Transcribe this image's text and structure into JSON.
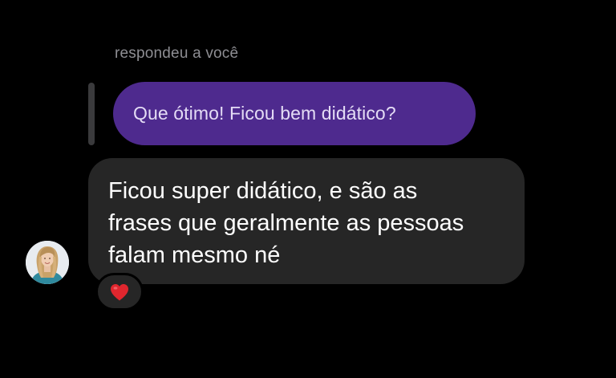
{
  "reply_header": {
    "text": "respondeu a você"
  },
  "quoted_message": {
    "text": "Que ótimo! Ficou bem didático?",
    "bubble_color": "#4e2a8e"
  },
  "message": {
    "lines": [
      "Ficou super didático, e são as",
      "frases que geralmente as pessoas",
      "falam mesmo né"
    ],
    "bubble_color": "#262626"
  },
  "sender_avatar": {
    "icon": "profile-photo"
  },
  "reaction": {
    "icon": "red-heart-icon",
    "color": "#e0262e"
  },
  "colors": {
    "background": "#000000",
    "meta_text": "#8e8e93",
    "message_text": "#ffffff"
  }
}
